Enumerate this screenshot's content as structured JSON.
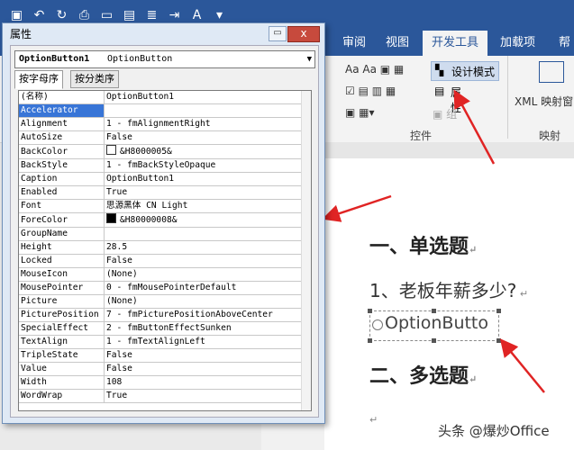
{
  "ribbon": {
    "tabs": [
      "审阅",
      "视图",
      "开发工具",
      "加载项",
      "帮"
    ],
    "active_tab": "开发工具",
    "design_mode": "设计模式",
    "properties": "属性",
    "group_label": "组",
    "controls_group": "控件",
    "xml_mapping": "XML 映射窗",
    "mapping_group": "映射"
  },
  "properties_window": {
    "title": "属性",
    "close": "x",
    "selector_name": "OptionButton1",
    "selector_type": "OptionButton",
    "tab_alpha": "按字母序",
    "tab_category": "按分类序",
    "rows": [
      [
        "(名称)",
        "OptionButton1"
      ],
      [
        "Accelerator",
        ""
      ],
      [
        "Alignment",
        "1 - fmAlignmentRight"
      ],
      [
        "AutoSize",
        "False"
      ],
      [
        "BackColor",
        "&H8000005&"
      ],
      [
        "BackStyle",
        "1 - fmBackStyleOpaque"
      ],
      [
        "Caption",
        "OptionButton1"
      ],
      [
        "Enabled",
        "True"
      ],
      [
        "Font",
        "思源黑体 CN Light"
      ],
      [
        "ForeColor",
        "&H80000008&"
      ],
      [
        "GroupName",
        ""
      ],
      [
        "Height",
        "28.5"
      ],
      [
        "Locked",
        "False"
      ],
      [
        "MouseIcon",
        "(None)"
      ],
      [
        "MousePointer",
        "0 - fmMousePointerDefault"
      ],
      [
        "Picture",
        "(None)"
      ],
      [
        "PicturePosition",
        "7 - fmPicturePositionAboveCenter"
      ],
      [
        "SpecialEffect",
        "2 - fmButtonEffectSunken"
      ],
      [
        "TextAlign",
        "1 - fmTextAlignLeft"
      ],
      [
        "TripleState",
        "False"
      ],
      [
        "Value",
        "False"
      ],
      [
        "Width",
        "108"
      ],
      [
        "WordWrap",
        "True"
      ]
    ]
  },
  "document": {
    "heading1": "一、单选题",
    "question": "1、老板年薪多少?",
    "option_caption": "OptionButto",
    "heading2": "二、多选题"
  },
  "watermark": "头条 @爆炒Office",
  "colors": {
    "ribbon_blue": "#2b579a",
    "arrow_red": "#e02424",
    "selected_row": "#3875d7"
  }
}
